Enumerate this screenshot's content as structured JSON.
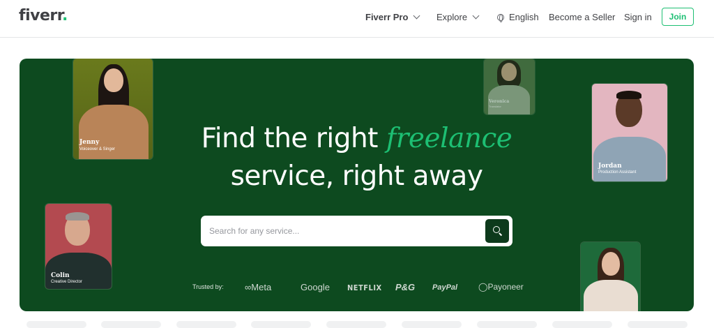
{
  "header": {
    "logo_text": "fiverr",
    "logo_dot": ".",
    "nav": {
      "fiverr_pro": "Fiverr Pro",
      "explore": "Explore",
      "language": "English",
      "become_seller": "Become a Seller",
      "sign_in": "Sign in",
      "join": "Join"
    }
  },
  "hero": {
    "title_part1": "Find the right ",
    "title_accent": "freelance",
    "title_line2": "service, right away",
    "search": {
      "placeholder": "Search for any service..."
    },
    "trusted_label": "Trusted by:",
    "brands": [
      "Meta",
      "Google",
      "NETFLIX",
      "P&G",
      "PayPal",
      "Payoneer"
    ],
    "profiles": [
      {
        "name": "Jenny",
        "role": "Voiceover & Singer"
      },
      {
        "name": "Veronica",
        "role": "Translator"
      },
      {
        "name": "Jordan",
        "role": "Production Assistant"
      },
      {
        "name": "Colin",
        "role": "Creative Director"
      }
    ]
  },
  "colors": {
    "brand_green": "#1dbf73",
    "hero_bg": "#0d4a1f",
    "search_button": "#0d3a1c"
  }
}
